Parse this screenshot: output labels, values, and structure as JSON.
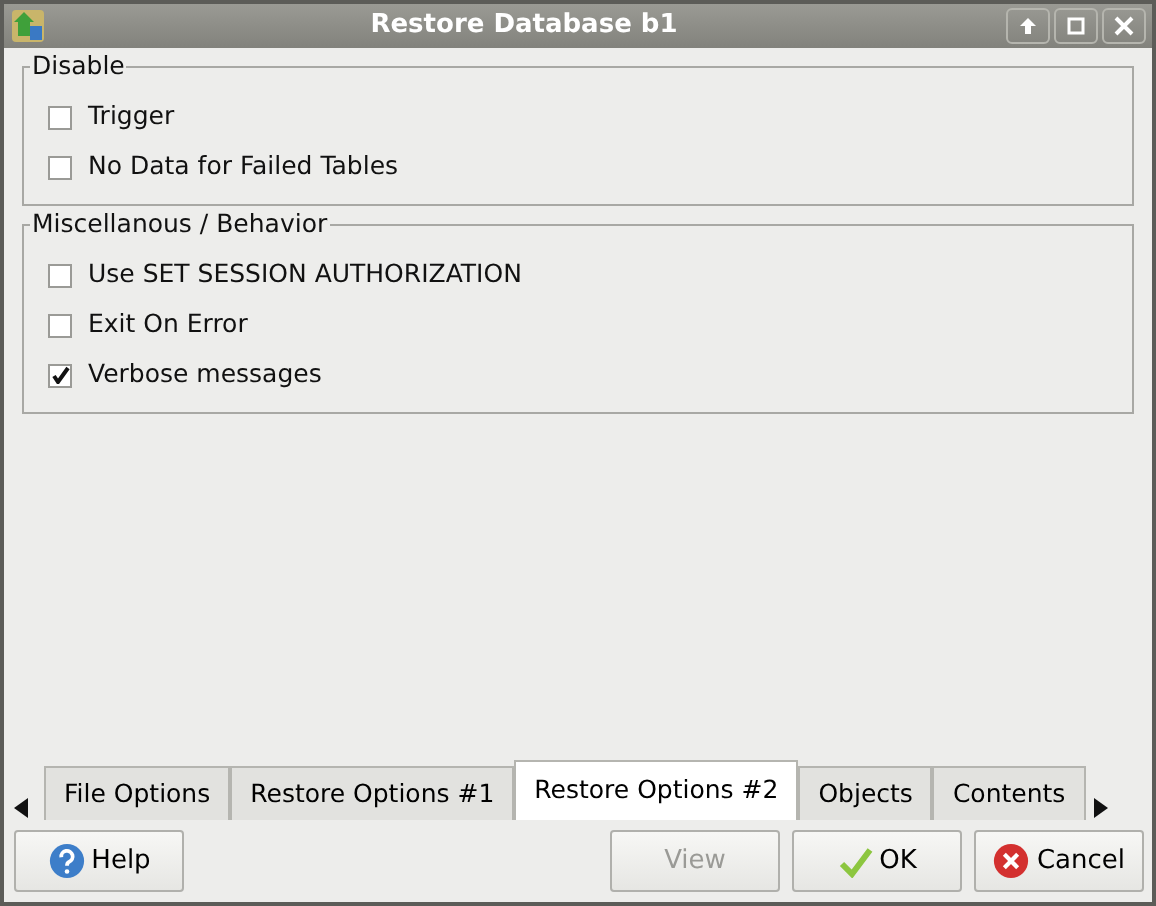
{
  "window": {
    "title": "Restore Database b1"
  },
  "groups": [
    {
      "title": "Disable",
      "options": [
        {
          "label": "Trigger",
          "checked": false
        },
        {
          "label": "No Data for Failed Tables",
          "checked": false
        }
      ]
    },
    {
      "title": "Miscellanous / Behavior",
      "options": [
        {
          "label": "Use SET SESSION AUTHORIZATION",
          "checked": false
        },
        {
          "label": "Exit On Error",
          "checked": false
        },
        {
          "label": "Verbose messages",
          "checked": true
        }
      ]
    }
  ],
  "tabs": [
    {
      "label": "File Options",
      "selected": false
    },
    {
      "label": "Restore Options #1",
      "selected": false
    },
    {
      "label": "Restore Options #2",
      "selected": true
    },
    {
      "label": "Objects",
      "selected": false
    },
    {
      "label": "Contents",
      "selected": false
    }
  ],
  "buttons": [
    {
      "label": "Help",
      "kind": "help",
      "disabled": false
    },
    {
      "label": "View",
      "kind": "plain",
      "disabled": true
    },
    {
      "label": "OK",
      "kind": "ok",
      "disabled": false
    },
    {
      "label": "Cancel",
      "kind": "cancel",
      "disabled": false
    }
  ]
}
